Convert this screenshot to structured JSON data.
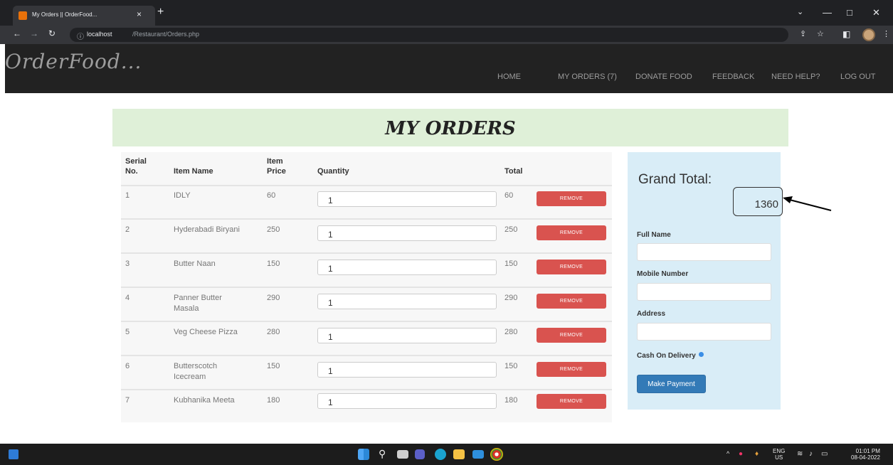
{
  "browser": {
    "tab_title": "My Orders || OrderFood...",
    "tab_close": "×",
    "new_tab": "+",
    "url_host": "localhost",
    "url_path": "/Restaurant/Orders.php",
    "controls": {
      "minimize": "—",
      "maximize": "□",
      "close": "✕",
      "chevron": "⌄"
    }
  },
  "site": {
    "logo": "OrderFood...",
    "menu": [
      "HOME",
      "MY ORDERS (7)",
      "DONATE FOOD",
      "FEEDBACK",
      "NEED HELP?",
      "LOG OUT"
    ]
  },
  "page": {
    "title": "MY ORDERS",
    "table_headers": {
      "serial": "Serial No.",
      "item_name": "Item Name",
      "item_price": "Item Price",
      "quantity": "Quantity",
      "total": "Total"
    },
    "remove_label": "REMOVE",
    "rows": [
      {
        "serial": "1",
        "name": "IDLY",
        "price": "60",
        "qty": "1",
        "total": "60"
      },
      {
        "serial": "2",
        "name": "Hyderabadi Biryani",
        "price": "250",
        "qty": "1",
        "total": "250"
      },
      {
        "serial": "3",
        "name": "Butter Naan",
        "price": "150",
        "qty": "1",
        "total": "150"
      },
      {
        "serial": "4",
        "name": "Panner Butter Masala",
        "price": "290",
        "qty": "1",
        "total": "290"
      },
      {
        "serial": "5",
        "name": "Veg Cheese Pizza",
        "price": "280",
        "qty": "1",
        "total": "280"
      },
      {
        "serial": "6",
        "name": "Butterscotch Icecream",
        "price": "150",
        "qty": "1",
        "total": "150"
      },
      {
        "serial": "7",
        "name": "Kubhanika Meeta",
        "price": "180",
        "qty": "1",
        "total": "180"
      }
    ]
  },
  "checkout": {
    "grand_total_label": "Grand Total:",
    "grand_total_value": "1360",
    "full_name_label": "Full Name",
    "mobile_label": "Mobile Number",
    "address_label": "Address",
    "cod_label": "Cash On Delivery",
    "pay_button": "Make Payment"
  },
  "taskbar": {
    "lang_top": "ENG",
    "lang_bottom": "US",
    "time": "01:01 PM",
    "date": "08-04-2022"
  },
  "colors": {
    "header_bg": "#222222",
    "banner_bg": "#dff0d8",
    "panel_bg": "#d9edf7",
    "remove_btn": "#d9534f",
    "pay_btn": "#337ab7"
  }
}
